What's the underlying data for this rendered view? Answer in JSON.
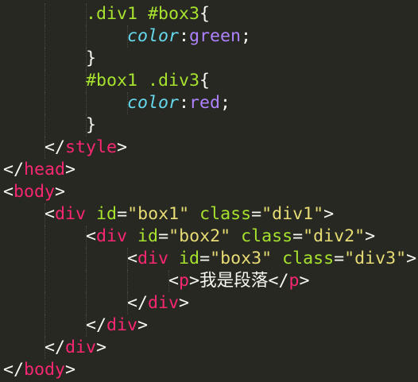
{
  "editor": {
    "theme": "monokai",
    "background": "#272822",
    "colors": {
      "tag": "#f92672",
      "attribute": "#a6e22e",
      "string": "#e6db74",
      "selector": "#a6e22e",
      "property": "#66d9ef",
      "value": "#ae81ff",
      "punctuation": "#f8f8f2"
    },
    "lines": [
      {
        "indent": 2,
        "tokens": [
          {
            "t": "sel",
            "v": ".div1 #box3"
          },
          {
            "t": "pun",
            "v": "{"
          }
        ]
      },
      {
        "indent": 3,
        "tokens": [
          {
            "t": "prop",
            "v": "color"
          },
          {
            "t": "pun",
            "v": ":"
          },
          {
            "t": "val",
            "v": "green"
          },
          {
            "t": "pun",
            "v": ";"
          }
        ]
      },
      {
        "indent": 2,
        "tokens": [
          {
            "t": "pun",
            "v": "}"
          }
        ]
      },
      {
        "indent": 2,
        "tokens": [
          {
            "t": "sel",
            "v": "#box1 .div3"
          },
          {
            "t": "pun",
            "v": "{"
          }
        ]
      },
      {
        "indent": 3,
        "tokens": [
          {
            "t": "prop",
            "v": "color"
          },
          {
            "t": "pun",
            "v": ":"
          },
          {
            "t": "val",
            "v": "red"
          },
          {
            "t": "pun",
            "v": ";"
          }
        ]
      },
      {
        "indent": 2,
        "tokens": [
          {
            "t": "pun",
            "v": "}"
          }
        ]
      },
      {
        "indent": 1,
        "tokens": [
          {
            "t": "pun",
            "v": "</"
          },
          {
            "t": "tag",
            "v": "style"
          },
          {
            "t": "pun",
            "v": ">"
          }
        ]
      },
      {
        "indent": 0,
        "tokens": [
          {
            "t": "pun",
            "v": "</"
          },
          {
            "t": "tag",
            "v": "head"
          },
          {
            "t": "pun",
            "v": ">"
          }
        ]
      },
      {
        "indent": 0,
        "tokens": [
          {
            "t": "pun",
            "v": "<"
          },
          {
            "t": "tag",
            "v": "body"
          },
          {
            "t": "pun",
            "v": ">"
          }
        ]
      },
      {
        "indent": 1,
        "tokens": [
          {
            "t": "pun",
            "v": "<"
          },
          {
            "t": "tag",
            "v": "div"
          },
          {
            "t": "txt",
            "v": " "
          },
          {
            "t": "attr",
            "v": "id"
          },
          {
            "t": "pun",
            "v": "="
          },
          {
            "t": "str",
            "v": "\"box1\""
          },
          {
            "t": "txt",
            "v": " "
          },
          {
            "t": "attr",
            "v": "class"
          },
          {
            "t": "pun",
            "v": "="
          },
          {
            "t": "str",
            "v": "\"div1\""
          },
          {
            "t": "pun",
            "v": ">"
          }
        ]
      },
      {
        "indent": 2,
        "tokens": [
          {
            "t": "pun",
            "v": "<"
          },
          {
            "t": "tag",
            "v": "div"
          },
          {
            "t": "txt",
            "v": " "
          },
          {
            "t": "attr",
            "v": "id"
          },
          {
            "t": "pun",
            "v": "="
          },
          {
            "t": "str",
            "v": "\"box2\""
          },
          {
            "t": "txt",
            "v": " "
          },
          {
            "t": "attr",
            "v": "class"
          },
          {
            "t": "pun",
            "v": "="
          },
          {
            "t": "str",
            "v": "\"div2\""
          },
          {
            "t": "pun",
            "v": ">"
          }
        ]
      },
      {
        "indent": 3,
        "tokens": [
          {
            "t": "pun",
            "v": "<"
          },
          {
            "t": "tag",
            "v": "div"
          },
          {
            "t": "txt",
            "v": " "
          },
          {
            "t": "attr",
            "v": "id"
          },
          {
            "t": "pun",
            "v": "="
          },
          {
            "t": "str",
            "v": "\"box3\""
          },
          {
            "t": "txt",
            "v": " "
          },
          {
            "t": "attr",
            "v": "class"
          },
          {
            "t": "pun",
            "v": "="
          },
          {
            "t": "str",
            "v": "\"div3\""
          },
          {
            "t": "pun",
            "v": ">"
          }
        ]
      },
      {
        "indent": 4,
        "tokens": [
          {
            "t": "pun",
            "v": "<"
          },
          {
            "t": "tag",
            "v": "p"
          },
          {
            "t": "pun",
            "v": ">"
          },
          {
            "t": "txt",
            "v": "我是段落"
          },
          {
            "t": "pun",
            "v": "</"
          },
          {
            "t": "tag",
            "v": "p"
          },
          {
            "t": "pun",
            "v": ">"
          }
        ]
      },
      {
        "indent": 3,
        "tokens": [
          {
            "t": "pun",
            "v": "</"
          },
          {
            "t": "tag",
            "v": "div"
          },
          {
            "t": "pun",
            "v": ">"
          }
        ]
      },
      {
        "indent": 2,
        "tokens": [
          {
            "t": "pun",
            "v": "</"
          },
          {
            "t": "tag",
            "v": "div"
          },
          {
            "t": "pun",
            "v": ">"
          }
        ]
      },
      {
        "indent": 1,
        "tokens": [
          {
            "t": "pun",
            "v": "</"
          },
          {
            "t": "tag",
            "v": "div"
          },
          {
            "t": "pun",
            "v": ">"
          }
        ]
      },
      {
        "indent": 0,
        "tokens": [
          {
            "t": "pun",
            "v": "</"
          },
          {
            "t": "tag",
            "v": "body"
          },
          {
            "t": "pun",
            "v": ">"
          }
        ]
      }
    ]
  }
}
